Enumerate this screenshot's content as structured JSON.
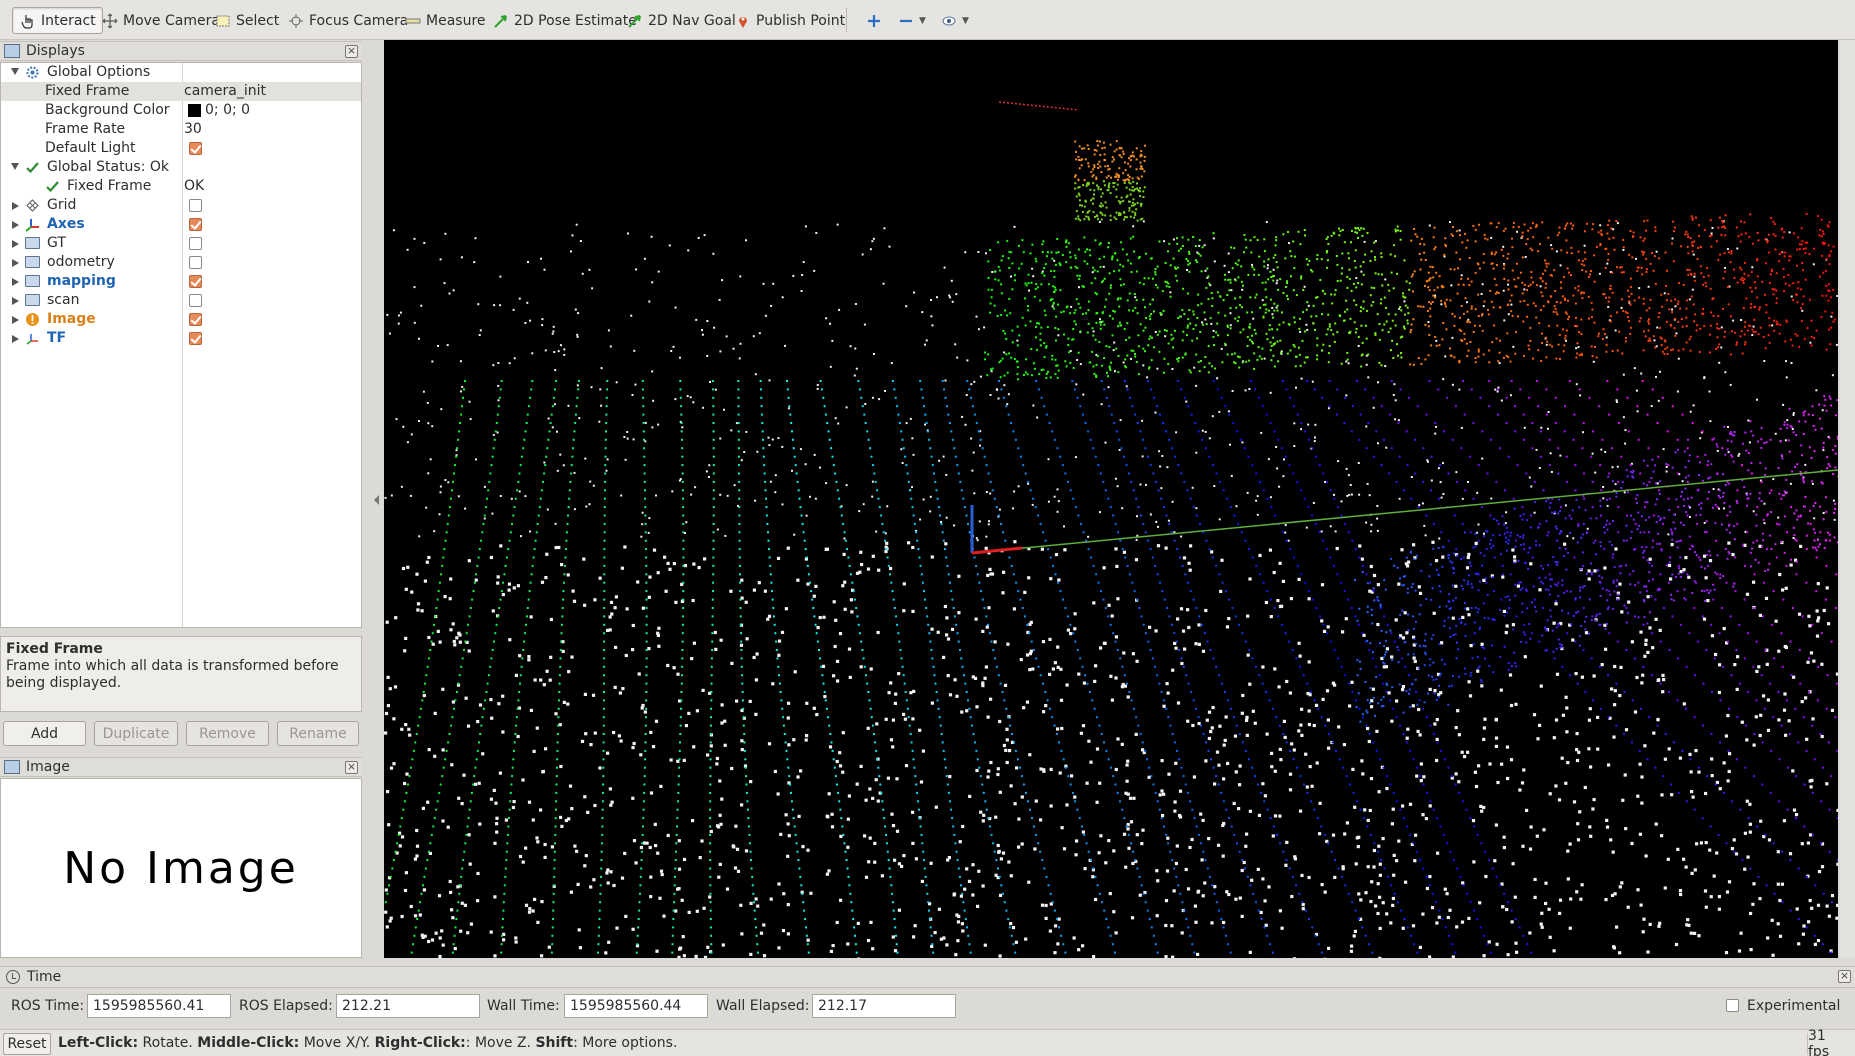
{
  "toolbar": {
    "interact": "Interact",
    "move_camera": "Move Camera",
    "select": "Select",
    "focus_camera": "Focus Camera",
    "measure": "Measure",
    "pose_estimate": "2D Pose Estimate",
    "nav_goal": "2D Nav Goal",
    "publish_point": "Publish Point"
  },
  "displays_panel": {
    "title": "Displays",
    "rows": [
      {
        "label": "Global Options",
        "value": ""
      },
      {
        "label": "Fixed Frame",
        "value": "camera_init"
      },
      {
        "label": "Background Color",
        "value": "0; 0; 0"
      },
      {
        "label": "Frame Rate",
        "value": "30"
      },
      {
        "label": "Default Light",
        "value": ""
      },
      {
        "label": "Global Status: Ok",
        "value": ""
      },
      {
        "label": "Fixed Frame",
        "value": "OK"
      },
      {
        "label": "Grid",
        "checked": false
      },
      {
        "label": "Axes",
        "checked": true
      },
      {
        "label": "GT",
        "checked": false
      },
      {
        "label": "odometry",
        "checked": false
      },
      {
        "label": "mapping",
        "checked": true
      },
      {
        "label": "scan",
        "checked": false
      },
      {
        "label": "Image",
        "checked": true
      },
      {
        "label": "TF",
        "checked": true
      }
    ]
  },
  "description": {
    "title": "Fixed Frame",
    "text": "Frame into which all data is transformed before being displayed."
  },
  "buttons": {
    "add": "Add",
    "duplicate": "Duplicate",
    "remove": "Remove",
    "rename": "Rename"
  },
  "image_panel": {
    "title": "Image",
    "placeholder": "No Image"
  },
  "time_panel": {
    "title": "Time",
    "ros_time_label": "ROS Time:",
    "ros_time": "1595985560.41",
    "ros_elapsed_label": "ROS Elapsed:",
    "ros_elapsed": "212.21",
    "wall_time_label": "Wall Time:",
    "wall_time": "1595985560.44",
    "wall_elapsed_label": "Wall Elapsed:",
    "wall_elapsed": "212.17",
    "experimental": "Experimental"
  },
  "statusbar": {
    "reset": "Reset",
    "left_click": "Left-Click:",
    "left_click_text": " Rotate. ",
    "middle_click": "Middle-Click:",
    "middle_click_text": " Move X/Y. ",
    "right_click": "Right-Click:",
    "right_click_text": ": Move Z. ",
    "shift": "Shift",
    "shift_text": ": More options.",
    "fps": "31 fps"
  },
  "colors": {
    "viewport_bg": "#000000",
    "check_on": "#e58a5a",
    "blue_label": "#1f64b4",
    "orange_label": "#d98017"
  }
}
